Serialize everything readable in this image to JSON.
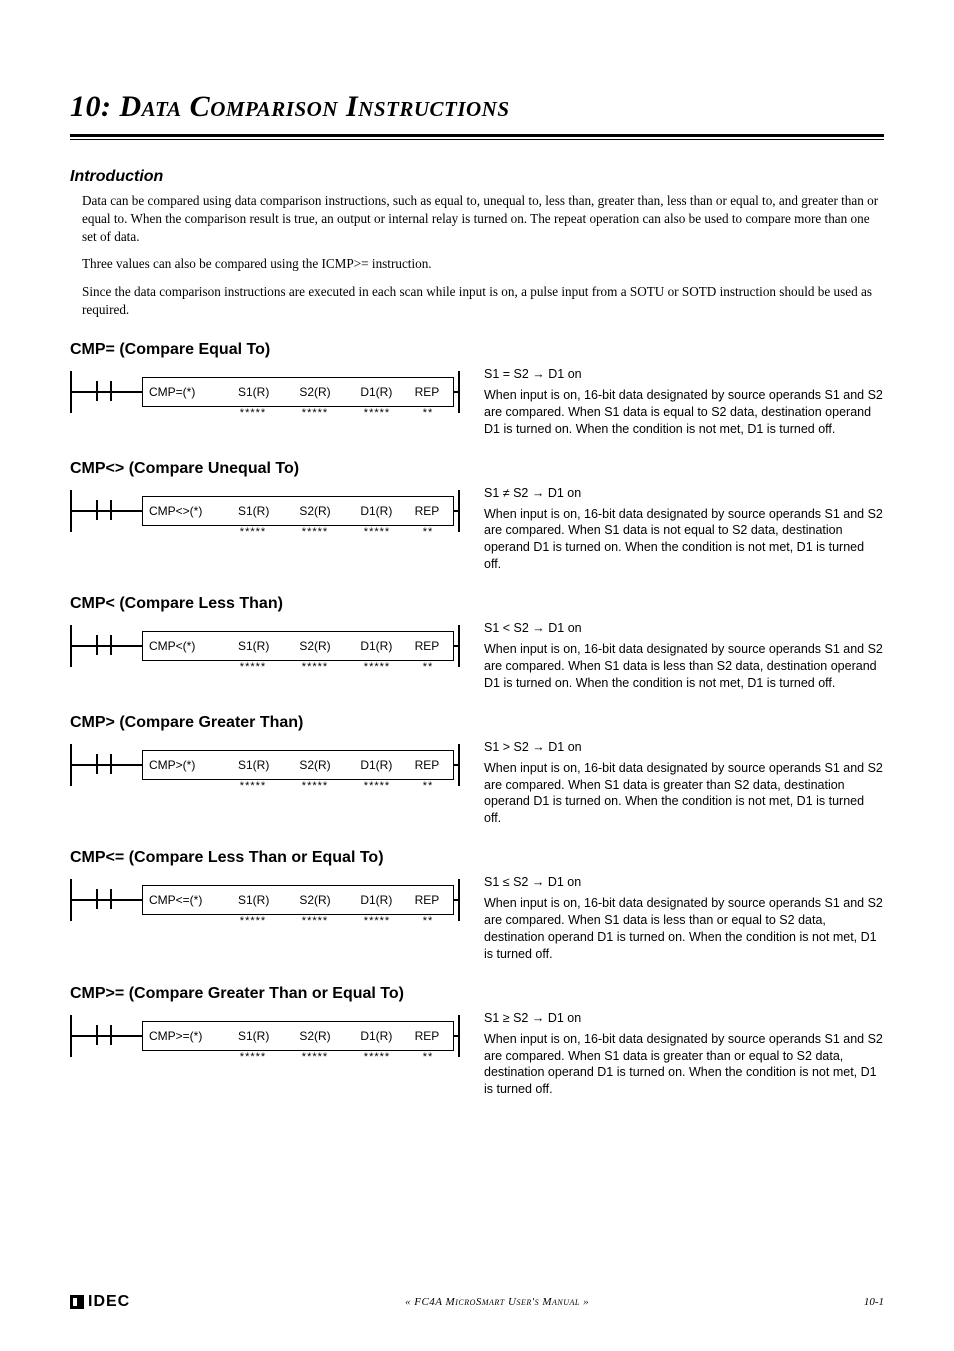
{
  "chapter": {
    "title": "10: Data Comparison Instructions"
  },
  "intro": {
    "heading": "Introduction",
    "p1": "Data can be compared using data comparison instructions, such as equal to, unequal to, less than, greater than, less than or equal to, and greater than or equal to. When the comparison result is true, an output or internal relay is turned on. The repeat operation can also be used to compare more than one set of data.",
    "p2": "Three values can also be compared using the ICMP>= instruction.",
    "p3": "Since the data comparison instructions are executed in each scan while input is on, a pulse input from a SOTU or SOTD instruction should be used as required."
  },
  "columns": {
    "s1": "S1(R)",
    "s2": "S2(R)",
    "d1": "D1(R)",
    "rep": "REP",
    "stars5": "*****",
    "stars2": "**"
  },
  "sections": [
    {
      "heading": "CMP= (Compare Equal To)",
      "op": "CMP=(*)",
      "cond": "S1 = S2 → D1 on",
      "desc": "When input is on, 16-bit data designated by source operands S1 and S2 are compared. When S1 data is equal to S2 data, destination operand D1 is turned on. When the condition is not met, D1 is turned off."
    },
    {
      "heading": "CMP<> (Compare Unequal To)",
      "op": "CMP<>(*)",
      "cond": "S1 ≠ S2 → D1 on",
      "desc": "When input is on, 16-bit data designated by source operands S1 and S2 are compared. When S1 data is not equal to S2 data, destination operand D1 is turned on. When the condition is not met, D1 is turned off."
    },
    {
      "heading": "CMP< (Compare Less Than)",
      "op": "CMP<(*)",
      "cond": "S1 < S2 → D1 on",
      "desc": "When input is on, 16-bit data designated by source operands S1 and S2 are compared. When S1 data is less than S2 data, destination operand D1 is turned on. When the condition is not met, D1 is turned off."
    },
    {
      "heading": "CMP> (Compare Greater Than)",
      "op": "CMP>(*)",
      "cond": "S1 > S2 → D1 on",
      "desc": "When input is on, 16-bit data designated by source operands S1 and S2 are compared. When S1 data is greater than S2 data, destination operand D1 is turned on. When the condition is not met, D1 is turned off."
    },
    {
      "heading": "CMP<= (Compare Less Than or Equal To)",
      "op": "CMP<=(*)",
      "cond": "S1 ≤ S2 → D1 on",
      "desc": "When input is on, 16-bit data designated by source operands S1 and S2 are compared. When S1 data is less than or equal to S2 data, destination operand D1 is turned on. When the condition is not met, D1 is turned off."
    },
    {
      "heading": "CMP>= (Compare Greater Than or Equal To)",
      "op": "CMP>=(*)",
      "cond": "S1 ≥ S2 → D1 on",
      "desc": "When input is on, 16-bit data designated by source operands S1 and S2 are compared. When S1 data is greater than or equal to S2 data, destination operand D1 is turned on. When the condition is not met, D1 is turned off."
    }
  ],
  "footer": {
    "logo": "IDEC",
    "center": "« FC4A MicroSmart User's Manual »",
    "page": "10-1"
  }
}
